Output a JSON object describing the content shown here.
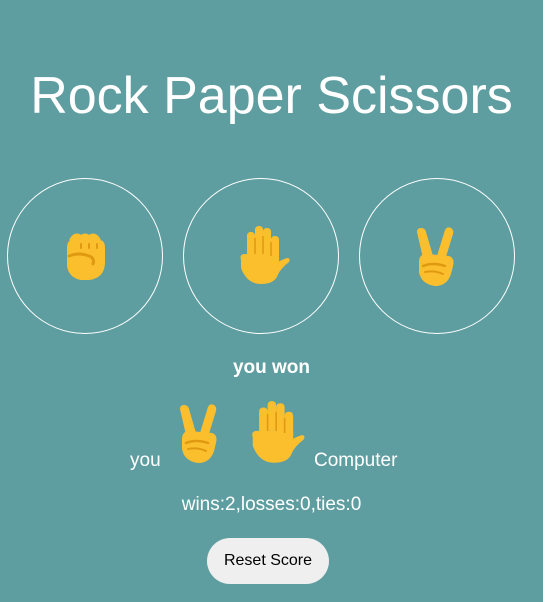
{
  "title": "Rock Paper Scissors",
  "choices": [
    {
      "name": "rock",
      "icon": "raised-fist-icon"
    },
    {
      "name": "paper",
      "icon": "raised-hand-icon"
    },
    {
      "name": "scissors",
      "icon": "victory-hand-icon"
    }
  ],
  "result": {
    "message": "you won",
    "player_label": "you",
    "computer_label": "Computer",
    "player_move_icon": "victory-hand-icon",
    "computer_move_icon": "raised-hand-icon"
  },
  "score": {
    "text": "wins:2,losses:0,ties:0",
    "wins": 2,
    "losses": 0,
    "ties": 0
  },
  "reset_label": "Reset Score",
  "colors": {
    "background": "#5f9ea0",
    "emoji_skin": "#fbbf2e",
    "text": "#ffffff"
  }
}
